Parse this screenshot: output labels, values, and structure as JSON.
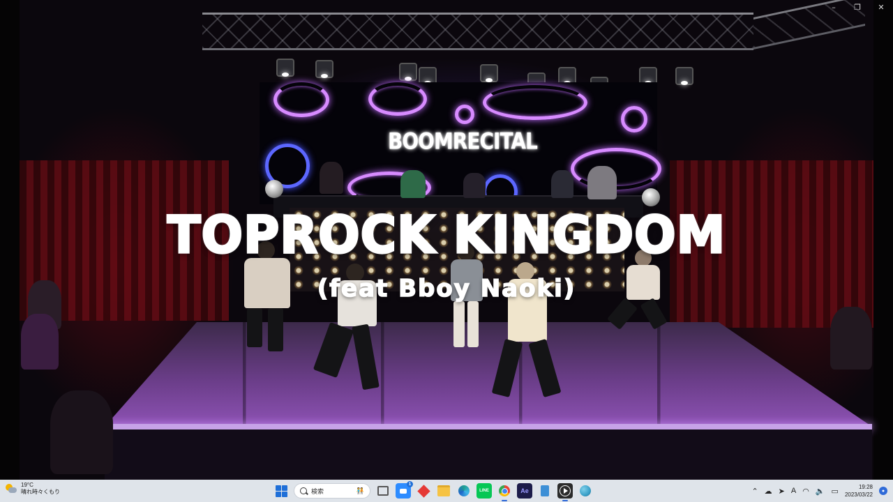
{
  "video": {
    "title_main": "TOPROCK KINGDOM",
    "title_sub": "(feat Bboy Naoki)",
    "event_logo": "BOOMRECITAL"
  },
  "window_controls": {
    "minimize": "–",
    "maximize": "❐",
    "close": "✕"
  },
  "taskbar": {
    "weather": {
      "temperature": "19°C",
      "description": "晴れ時々くもり",
      "icon": "partly-cloudy-icon"
    },
    "search": {
      "placeholder": "検索"
    },
    "apps": [
      {
        "name": "start",
        "icon": "windows-start-icon"
      },
      {
        "name": "task-view",
        "icon": "task-view-icon"
      },
      {
        "name": "zoom",
        "icon": "zoom-icon",
        "color": "#2d8cff"
      },
      {
        "name": "app-red",
        "icon": "red-diamond-icon",
        "color": "#e53935"
      },
      {
        "name": "file-explorer",
        "icon": "folder-icon",
        "color": "#f6c343"
      },
      {
        "name": "edge",
        "icon": "edge-icon",
        "color": "#1f9e8f"
      },
      {
        "name": "line",
        "icon": "line-icon",
        "color": "#06c755",
        "label": "LINE"
      },
      {
        "name": "chrome",
        "icon": "chrome-icon"
      },
      {
        "name": "after-effects",
        "icon": "after-effects-icon",
        "color": "#1c1c4a",
        "label": "Ae"
      },
      {
        "name": "notepad",
        "icon": "notepad-icon",
        "color": "#3c8fd6"
      },
      {
        "name": "media-player",
        "icon": "media-player-icon",
        "color": "#2b2b2b"
      },
      {
        "name": "globe-app",
        "icon": "globe-icon",
        "color": "#3aa0c8"
      }
    ],
    "tray": {
      "ime_mode": "A",
      "time": "19:28",
      "date": "2023/03/22"
    }
  }
}
